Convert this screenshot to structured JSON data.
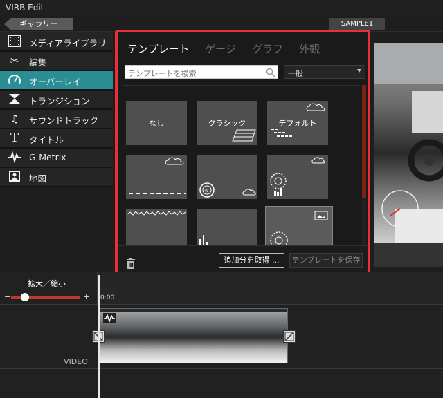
{
  "app": {
    "title": "VIRB Edit"
  },
  "toolbar": {
    "gallery_label": "ギャラリー",
    "project_name": "SAMPLE1"
  },
  "sidebar": {
    "items": [
      {
        "label": "メディアライブラリ",
        "icon": "film-icon"
      },
      {
        "label": "編集",
        "icon": "scissors-icon"
      },
      {
        "label": "オーバーレイ",
        "icon": "gauge-icon",
        "active": true
      },
      {
        "label": "トランジション",
        "icon": "transition-icon"
      },
      {
        "label": "サウンドトラック",
        "icon": "music-note-icon"
      },
      {
        "label": "タイトル",
        "icon": "title-t-icon"
      },
      {
        "label": "G-Metrix",
        "icon": "g-metrix-icon"
      },
      {
        "label": "地図",
        "icon": "map-icon"
      }
    ]
  },
  "overlay_panel": {
    "tabs": [
      {
        "label": "テンプレート",
        "active": true
      },
      {
        "label": "ゲージ",
        "active": false
      },
      {
        "label": "グラフ",
        "active": false
      },
      {
        "label": "外観",
        "active": false
      }
    ],
    "search": {
      "placeholder": "テンプレートを検索",
      "value": ""
    },
    "category": {
      "selected": "一般"
    },
    "templates": [
      {
        "label": "なし"
      },
      {
        "label": "クラシック"
      },
      {
        "label": "デフォルト"
      },
      {
        "label": ""
      },
      {
        "label": ""
      },
      {
        "label": ""
      },
      {
        "label": ""
      },
      {
        "label": ""
      },
      {
        "label": ""
      }
    ],
    "footer": {
      "get_more_label": "追加分を取得 ...",
      "save_template_label": "テンプレートを保存"
    }
  },
  "timeline": {
    "zoom_label": "拡大／縮小",
    "zoom_minus": "−",
    "zoom_plus": "+",
    "zoom_level": 0.2,
    "time_start": "0:00",
    "track_label": "VIDEO"
  },
  "colors": {
    "accent": "#2b8e95",
    "highlight_border": "#e8303a",
    "slider": "#c0392b"
  }
}
